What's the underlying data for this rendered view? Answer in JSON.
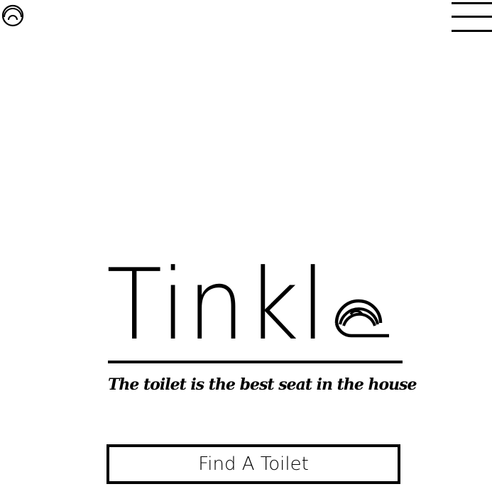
{
  "header": {
    "logo_icon": "toilet-seat-logo-icon",
    "menu_icon": "hamburger-menu-icon"
  },
  "hero": {
    "brand_name": "Tinkl",
    "brand_glyph_icon": "toilet-seat-letter-e-icon",
    "tagline": "The toilet is the best seat in the house",
    "cta_label": "Find A Toilet"
  },
  "colors": {
    "background": "#ffffff",
    "foreground": "#000000"
  }
}
